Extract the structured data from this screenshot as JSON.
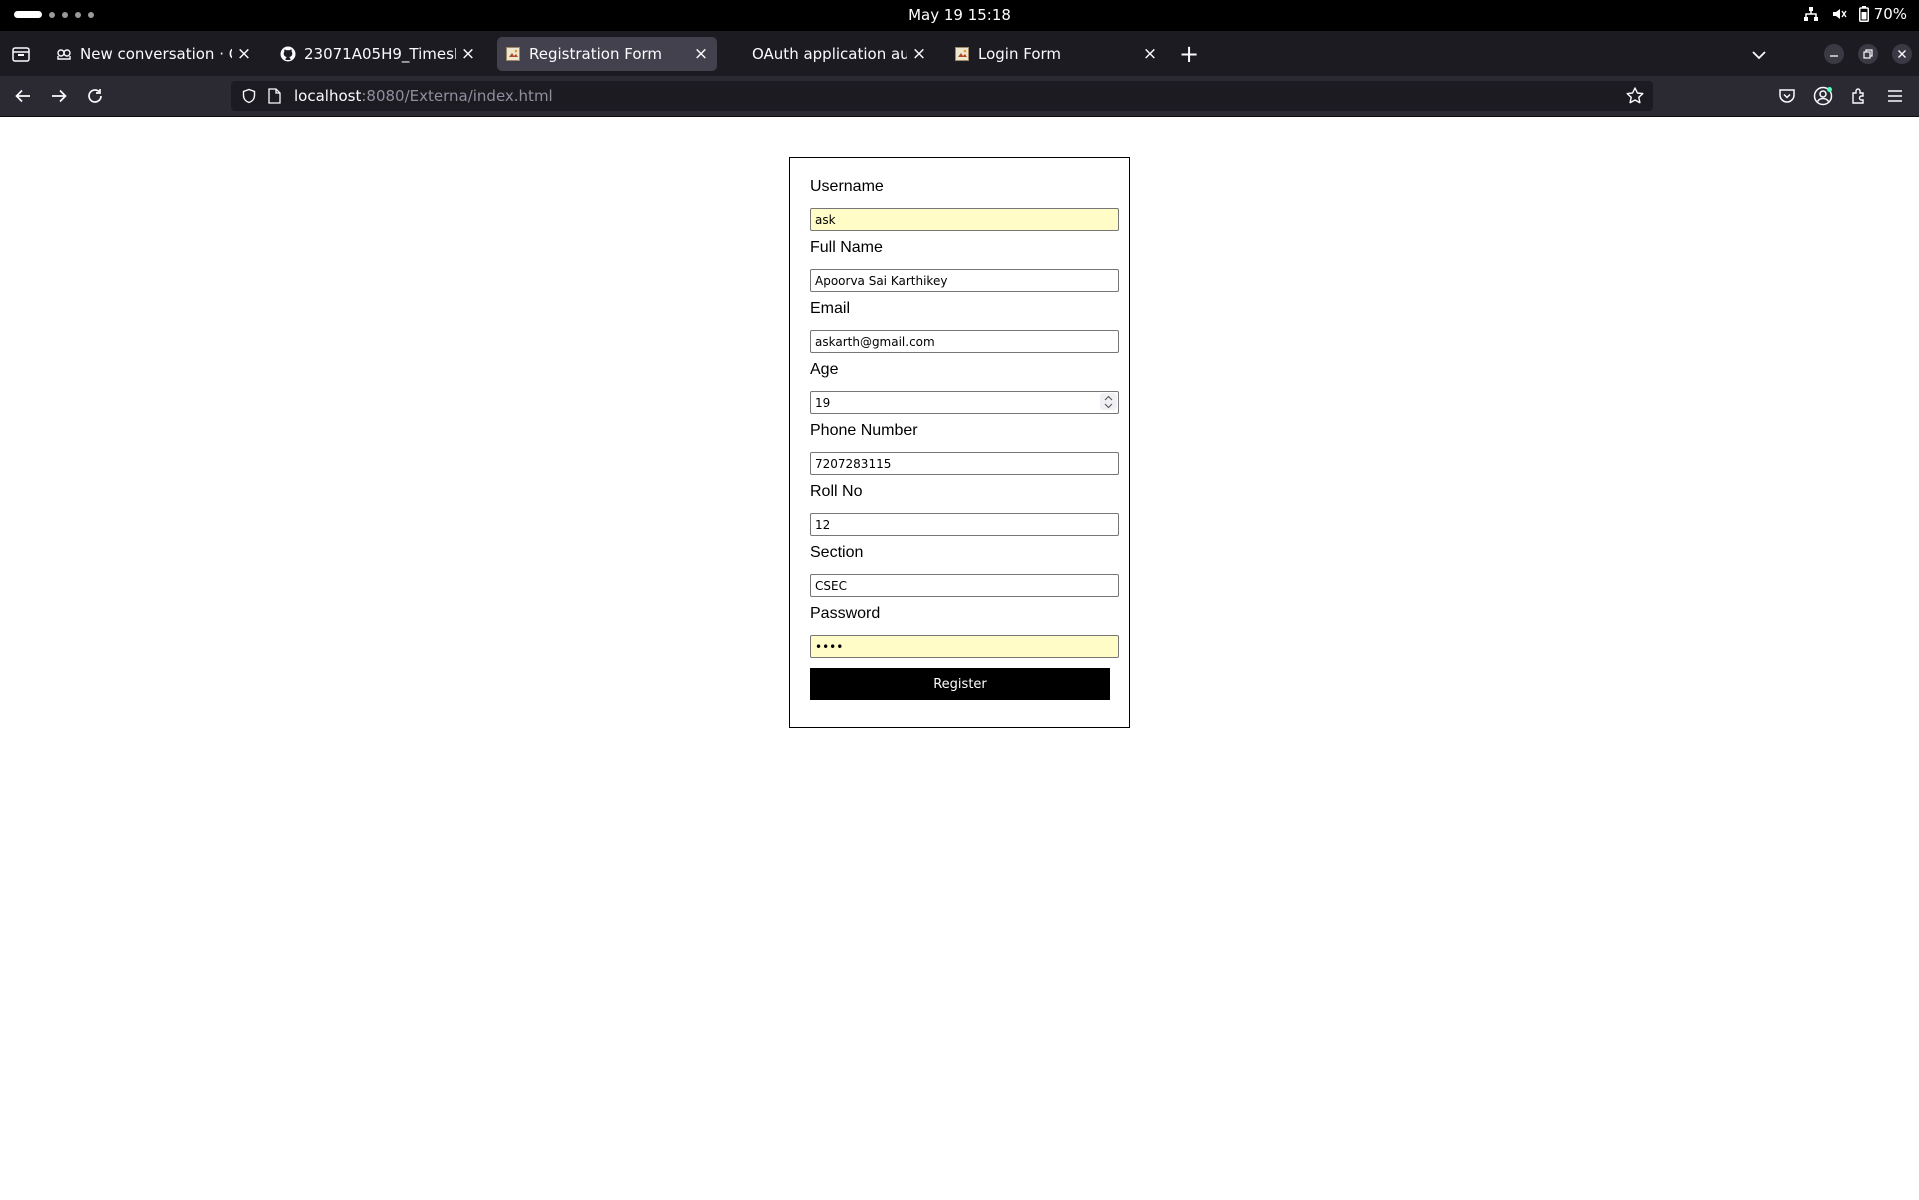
{
  "system_bar": {
    "clock": "May 19  15:18",
    "battery_label": "70%",
    "icons": [
      "network-icon",
      "volume-muted-icon",
      "battery-icon"
    ]
  },
  "browser": {
    "tabs": [
      {
        "title": "New conversation · GitHub Copilot",
        "icon": "copilot-icon",
        "selected": false
      },
      {
        "title": "23071A05H9_TimesLogger",
        "icon": "github-icon",
        "selected": false
      },
      {
        "title": "Registration Form",
        "icon": "page-icon",
        "selected": true
      },
      {
        "title": "OAuth application authorization",
        "icon": "none",
        "selected": false
      },
      {
        "title": "Login Form",
        "icon": "page-icon",
        "selected": false
      }
    ],
    "url": {
      "host": "localhost",
      "rest": ":8080/Externa/index.html"
    },
    "toolbar_icons": [
      "pocket-icon",
      "account-icon",
      "extensions-icon",
      "menu-icon"
    ]
  },
  "form": {
    "username": {
      "label": "Username",
      "value": "ask"
    },
    "fullname": {
      "label": "Full Name",
      "value": "Apoorva Sai Karthikey"
    },
    "email": {
      "label": "Email",
      "value": "askarth@gmail.com"
    },
    "age": {
      "label": "Age",
      "value": "19"
    },
    "phone": {
      "label": "Phone Number",
      "value": "7207283115"
    },
    "rollno": {
      "label": "Roll No",
      "value": "12"
    },
    "section": {
      "label": "Section",
      "value": "CSEC"
    },
    "password": {
      "label": "Password",
      "value": "••••"
    },
    "submit_label": "Register"
  },
  "colors": {
    "autofill_bg": "#fffcc8",
    "browser_chrome": "#1c1b22",
    "button_bg": "#000000"
  }
}
